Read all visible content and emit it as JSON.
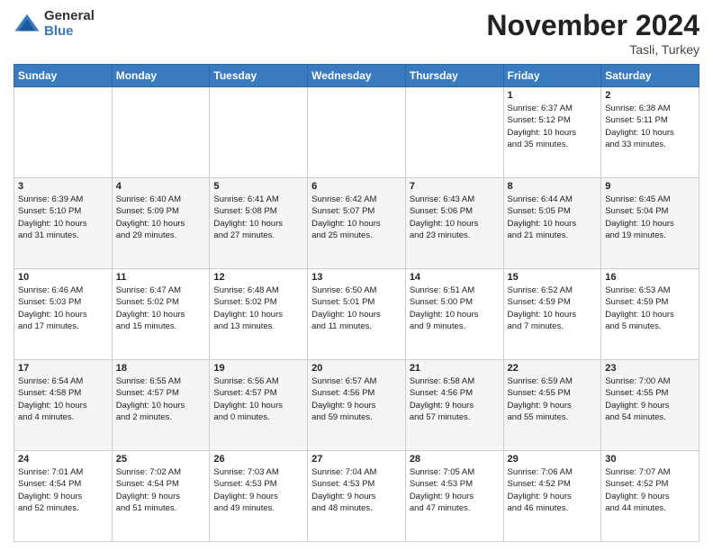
{
  "logo": {
    "general": "General",
    "blue": "Blue"
  },
  "header": {
    "month": "November 2024",
    "location": "Tasli, Turkey"
  },
  "weekdays": [
    "Sunday",
    "Monday",
    "Tuesday",
    "Wednesday",
    "Thursday",
    "Friday",
    "Saturday"
  ],
  "weeks": [
    [
      {
        "day": "",
        "detail": ""
      },
      {
        "day": "",
        "detail": ""
      },
      {
        "day": "",
        "detail": ""
      },
      {
        "day": "",
        "detail": ""
      },
      {
        "day": "",
        "detail": ""
      },
      {
        "day": "1",
        "detail": "Sunrise: 6:37 AM\nSunset: 5:12 PM\nDaylight: 10 hours\nand 35 minutes."
      },
      {
        "day": "2",
        "detail": "Sunrise: 6:38 AM\nSunset: 5:11 PM\nDaylight: 10 hours\nand 33 minutes."
      }
    ],
    [
      {
        "day": "3",
        "detail": "Sunrise: 6:39 AM\nSunset: 5:10 PM\nDaylight: 10 hours\nand 31 minutes."
      },
      {
        "day": "4",
        "detail": "Sunrise: 6:40 AM\nSunset: 5:09 PM\nDaylight: 10 hours\nand 29 minutes."
      },
      {
        "day": "5",
        "detail": "Sunrise: 6:41 AM\nSunset: 5:08 PM\nDaylight: 10 hours\nand 27 minutes."
      },
      {
        "day": "6",
        "detail": "Sunrise: 6:42 AM\nSunset: 5:07 PM\nDaylight: 10 hours\nand 25 minutes."
      },
      {
        "day": "7",
        "detail": "Sunrise: 6:43 AM\nSunset: 5:06 PM\nDaylight: 10 hours\nand 23 minutes."
      },
      {
        "day": "8",
        "detail": "Sunrise: 6:44 AM\nSunset: 5:05 PM\nDaylight: 10 hours\nand 21 minutes."
      },
      {
        "day": "9",
        "detail": "Sunrise: 6:45 AM\nSunset: 5:04 PM\nDaylight: 10 hours\nand 19 minutes."
      }
    ],
    [
      {
        "day": "10",
        "detail": "Sunrise: 6:46 AM\nSunset: 5:03 PM\nDaylight: 10 hours\nand 17 minutes."
      },
      {
        "day": "11",
        "detail": "Sunrise: 6:47 AM\nSunset: 5:02 PM\nDaylight: 10 hours\nand 15 minutes."
      },
      {
        "day": "12",
        "detail": "Sunrise: 6:48 AM\nSunset: 5:02 PM\nDaylight: 10 hours\nand 13 minutes."
      },
      {
        "day": "13",
        "detail": "Sunrise: 6:50 AM\nSunset: 5:01 PM\nDaylight: 10 hours\nand 11 minutes."
      },
      {
        "day": "14",
        "detail": "Sunrise: 6:51 AM\nSunset: 5:00 PM\nDaylight: 10 hours\nand 9 minutes."
      },
      {
        "day": "15",
        "detail": "Sunrise: 6:52 AM\nSunset: 4:59 PM\nDaylight: 10 hours\nand 7 minutes."
      },
      {
        "day": "16",
        "detail": "Sunrise: 6:53 AM\nSunset: 4:59 PM\nDaylight: 10 hours\nand 5 minutes."
      }
    ],
    [
      {
        "day": "17",
        "detail": "Sunrise: 6:54 AM\nSunset: 4:58 PM\nDaylight: 10 hours\nand 4 minutes."
      },
      {
        "day": "18",
        "detail": "Sunrise: 6:55 AM\nSunset: 4:57 PM\nDaylight: 10 hours\nand 2 minutes."
      },
      {
        "day": "19",
        "detail": "Sunrise: 6:56 AM\nSunset: 4:57 PM\nDaylight: 10 hours\nand 0 minutes."
      },
      {
        "day": "20",
        "detail": "Sunrise: 6:57 AM\nSunset: 4:56 PM\nDaylight: 9 hours\nand 59 minutes."
      },
      {
        "day": "21",
        "detail": "Sunrise: 6:58 AM\nSunset: 4:56 PM\nDaylight: 9 hours\nand 57 minutes."
      },
      {
        "day": "22",
        "detail": "Sunrise: 6:59 AM\nSunset: 4:55 PM\nDaylight: 9 hours\nand 55 minutes."
      },
      {
        "day": "23",
        "detail": "Sunrise: 7:00 AM\nSunset: 4:55 PM\nDaylight: 9 hours\nand 54 minutes."
      }
    ],
    [
      {
        "day": "24",
        "detail": "Sunrise: 7:01 AM\nSunset: 4:54 PM\nDaylight: 9 hours\nand 52 minutes."
      },
      {
        "day": "25",
        "detail": "Sunrise: 7:02 AM\nSunset: 4:54 PM\nDaylight: 9 hours\nand 51 minutes."
      },
      {
        "day": "26",
        "detail": "Sunrise: 7:03 AM\nSunset: 4:53 PM\nDaylight: 9 hours\nand 49 minutes."
      },
      {
        "day": "27",
        "detail": "Sunrise: 7:04 AM\nSunset: 4:53 PM\nDaylight: 9 hours\nand 48 minutes."
      },
      {
        "day": "28",
        "detail": "Sunrise: 7:05 AM\nSunset: 4:53 PM\nDaylight: 9 hours\nand 47 minutes."
      },
      {
        "day": "29",
        "detail": "Sunrise: 7:06 AM\nSunset: 4:52 PM\nDaylight: 9 hours\nand 46 minutes."
      },
      {
        "day": "30",
        "detail": "Sunrise: 7:07 AM\nSunset: 4:52 PM\nDaylight: 9 hours\nand 44 minutes."
      }
    ]
  ]
}
